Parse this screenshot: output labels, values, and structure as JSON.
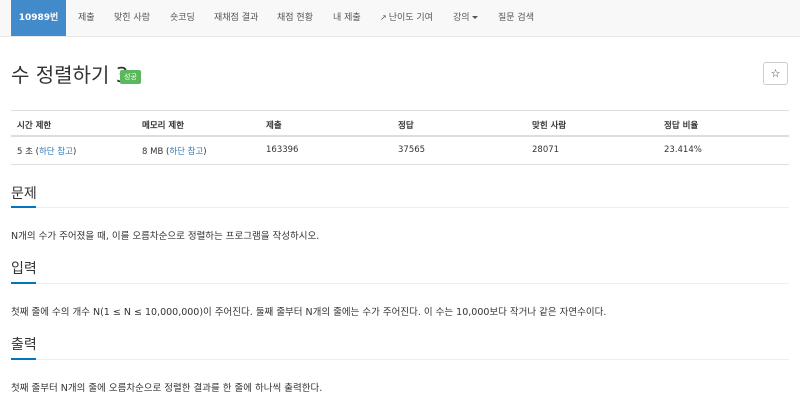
{
  "nav": {
    "problem_id": "10989번",
    "items": [
      "제출",
      "맞힌 사람",
      "숏코딩",
      "재채점 결과",
      "채점 현황",
      "내 제출",
      "난이도 기여",
      "강의",
      "질문 검색"
    ]
  },
  "problem": {
    "title": "수 정렬하기 3",
    "badge": "성공",
    "star": "☆"
  },
  "info_table": {
    "headers": [
      "시간 제한",
      "메모리 제한",
      "제출",
      "정답",
      "맞힌 사람",
      "정답 비율"
    ],
    "time_value": "5 초",
    "time_note_open": " (",
    "time_note_link": "하단 참고",
    "time_note_close": ")",
    "memory_value": "8 MB",
    "memory_note_open": " (",
    "memory_note_link": "하단 참고",
    "memory_note_close": ")",
    "submissions": "163396",
    "accepted": "37565",
    "solved_users": "28071",
    "ratio": "23.414%"
  },
  "sections": {
    "description": {
      "title": "문제",
      "text": "N개의 수가 주어졌을 때, 이를 오름차순으로 정렬하는 프로그램을 작성하시오."
    },
    "input": {
      "title": "입력",
      "text": "첫째 줄에 수의 개수 N(1 ≤ N ≤ 10,000,000)이 주어진다. 둘째 줄부터 N개의 줄에는 수가 주어진다. 이 수는 10,000보다 작거나 같은 자연수이다."
    },
    "output": {
      "title": "출력",
      "text": "첫째 줄부터 N개의 줄에 오름차순으로 정렬한 결과를 한 줄에 하나씩 출력한다."
    }
  },
  "colors": {
    "nav_active": "#428bca",
    "badge_success": "#5cb85c",
    "link": "#337ab7",
    "headline_accent": "#0076c0"
  },
  "icons": {
    "external_link": "external-link-icon",
    "caret": "caret-down-icon",
    "star": "star-icon"
  }
}
